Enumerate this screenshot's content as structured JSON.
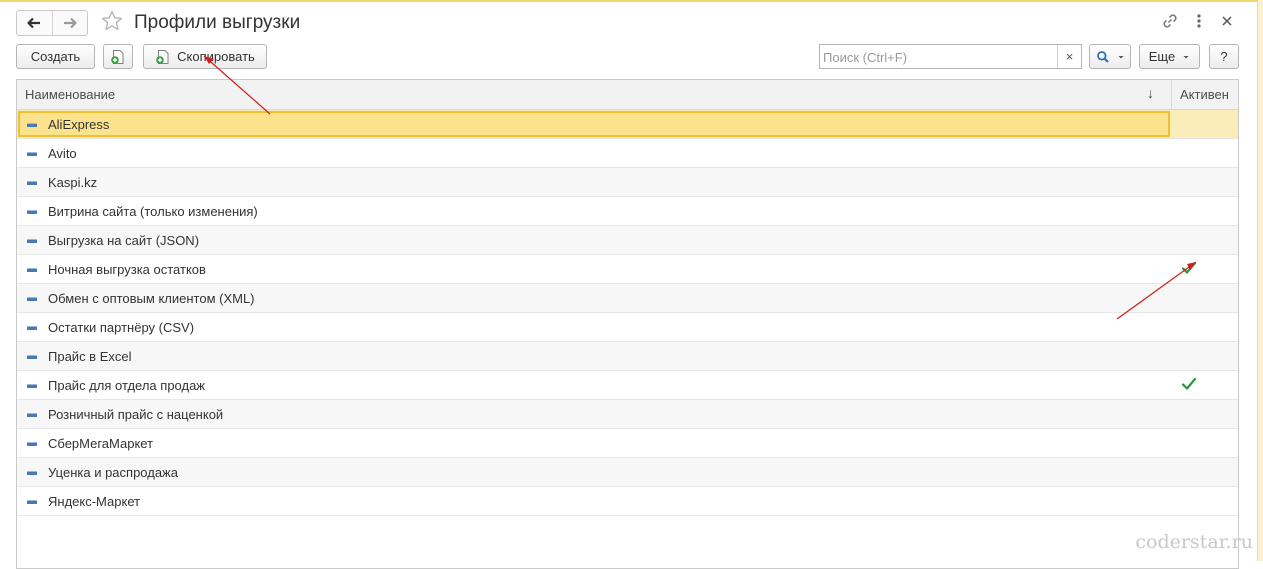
{
  "window": {
    "title": "Профили выгрузки"
  },
  "toolbar": {
    "create_label": "Создать",
    "copy_label": "Скопировать",
    "search_placeholder": "Поиск (Ctrl+F)",
    "search_clear": "×",
    "more_label": "Еще",
    "help_label": "?"
  },
  "table": {
    "columns": {
      "name": "Наименование",
      "sort_indicator": "↓",
      "active": "Активен"
    },
    "rows": [
      {
        "name": "AliExpress",
        "active": false,
        "selected": true
      },
      {
        "name": "Avito",
        "active": false
      },
      {
        "name": "Kaspi.kz",
        "active": false
      },
      {
        "name": "Витрина сайта (только изменения)",
        "active": false
      },
      {
        "name": "Выгрузка на сайт (JSON)",
        "active": false
      },
      {
        "name": "Ночная выгрузка остатков",
        "active": true
      },
      {
        "name": "Обмен с оптовым клиентом (XML)",
        "active": false
      },
      {
        "name": "Остатки партнёру (CSV)",
        "active": false
      },
      {
        "name": "Прайс в Excel",
        "active": false
      },
      {
        "name": "Прайс для отдела продаж",
        "active": true
      },
      {
        "name": "Розничный прайс с наценкой",
        "active": false
      },
      {
        "name": "СберМегаМаркет",
        "active": false
      },
      {
        "name": "Уценка и распродажа",
        "active": false
      },
      {
        "name": "Яндекс-Маркет",
        "active": false
      }
    ]
  },
  "watermark": "coderstar.ru",
  "icons": {
    "back": "arrow-left-icon",
    "forward": "arrow-right-icon",
    "favorite": "star-outline-icon",
    "link": "link-icon",
    "menu": "vertical-dots-icon",
    "close": "close-icon",
    "create_copy": "add-document-icon",
    "search": "magnifier-icon",
    "row": "list-item-icon",
    "active": "check-mark-icon"
  },
  "colors": {
    "selection": "#fbe38e",
    "selection_border": "#f0c12e",
    "check": "#1c9b3c",
    "annotation_arrow": "#d0201c"
  }
}
